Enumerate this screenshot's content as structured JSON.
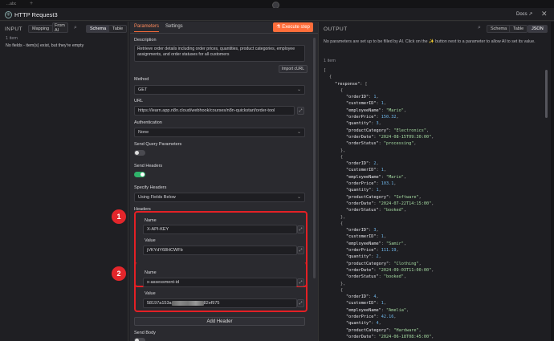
{
  "topbar": {
    "tab_text": "...abc"
  },
  "header": {
    "node_icon": "globe-icon",
    "title": "HTTP Request3",
    "docs_label": "Docs ↗",
    "close_icon": "close-icon"
  },
  "input_panel": {
    "label": "INPUT",
    "btn_mapping": "Mapping",
    "btn_from_ai": "From AI",
    "btn_schema": "Schema",
    "btn_table": "Table",
    "item_count": "1 item",
    "empty_note": "No fields - item(s) exist, but they're empty"
  },
  "center": {
    "tab_parameters": "Parameters",
    "tab_settings": "Settings",
    "execute_label": "Execute step",
    "description_label": "Description",
    "description_value": "Retrieve order details including order prices, quantities, product categories, employee assignments, and order statuses for all customers",
    "import_curl": "Import cURL",
    "method_label": "Method",
    "method_value": "GET",
    "url_label": "URL",
    "url_value": "https://learn.app.n8n.cloud/webhook/courses/n8n-quickstart/order-tool",
    "auth_label": "Authentication",
    "auth_value": "None",
    "send_query_label": "Send Query Parameters",
    "send_headers_label": "Send Headers",
    "specify_headers_label": "Specify Headers",
    "specify_headers_value": "Using Fields Below",
    "headers_label": "Headers",
    "header1_name_label": "Name",
    "header1_name_value": "X-API-KEY",
    "header1_value_label": "Value",
    "header1_value_value": "jVKYdY68HCWFb",
    "header2_name_label": "Name",
    "header2_name_value": "x-assessment-id",
    "header2_value_label": "Value",
    "header2_value_prefix": "58197a153a",
    "header2_value_suffix": "82ef975",
    "add_header_label": "Add Header",
    "send_body_label": "Send Body",
    "badge1": "1",
    "badge2": "2"
  },
  "output_panel": {
    "label": "OUTPUT",
    "btn_schema": "Schema",
    "btn_table": "Table",
    "btn_json": "JSON",
    "note": "No parameters are set up to be filled by AI. Click on the ✨ button next to a parameter to allow AI to set its value.",
    "item_count": "1 item",
    "orders": [
      {
        "orderID": "1",
        "customerID": "1",
        "employeeName": "\"Mario\"",
        "orderPrice": "150.32",
        "quantity": "3",
        "productCategory": "\"Electronics\"",
        "orderDate": "\"2024-08-15T09:30:00\"",
        "orderStatus": "\"processing\""
      },
      {
        "orderID": "2",
        "customerID": "1",
        "employeeName": "\"Mario\"",
        "orderPrice": "103.1",
        "quantity": "1",
        "productCategory": "\"Software\"",
        "orderDate": "\"2024-07-22T14:15:00\"",
        "orderStatus": "\"booked\""
      },
      {
        "orderID": "3",
        "customerID": "1",
        "employeeName": "\"Samir\"",
        "orderPrice": "111.19",
        "quantity": "2",
        "productCategory": "\"Clothing\"",
        "orderDate": "\"2024-09-03T11:00:00\"",
        "orderStatus": "\"booked\""
      },
      {
        "orderID": "4",
        "customerID": "1",
        "employeeName": "\"Amelia\"",
        "orderPrice": "42.16",
        "quantity": "4",
        "productCategory": "\"Hardware\"",
        "orderDate": "\"2024-06-18T08:45:00\"",
        "orderStatus": "\"booked\""
      }
    ]
  },
  "colors": {
    "accent": "#ff6d3a",
    "highlight_red": "#e32025",
    "toggle_on": "#2fb26a"
  }
}
